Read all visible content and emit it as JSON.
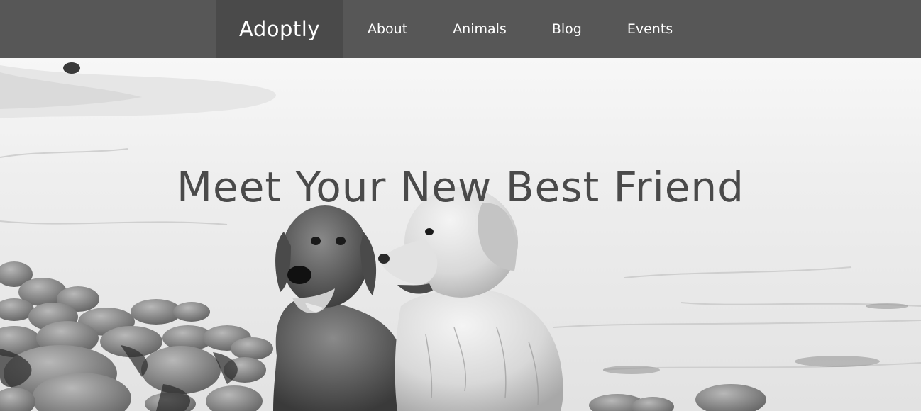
{
  "brand": {
    "name": "Adoptly",
    "colors": {
      "navbar_bg": "#575757",
      "brand_bg": "#4a4a4a",
      "nav_text": "#ffffff",
      "headline_text": "#4a4a4a"
    }
  },
  "nav": {
    "items": [
      {
        "label": "About"
      },
      {
        "label": "Animals"
      },
      {
        "label": "Blog"
      },
      {
        "label": "Events"
      }
    ]
  },
  "hero": {
    "headline": "Meet Your New Best Friend",
    "image": "two-dogs-on-rocky-beach-photo"
  }
}
